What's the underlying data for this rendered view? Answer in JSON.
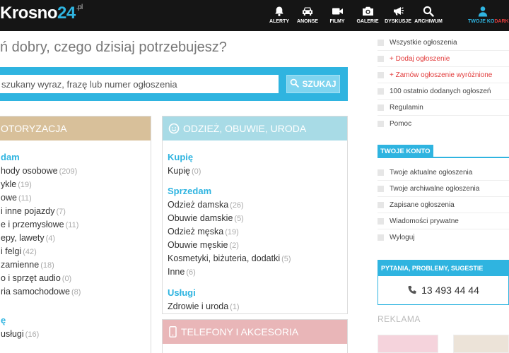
{
  "brand": {
    "logo_text": "Krosno",
    "logo_num": "24",
    "logo_tld": ".pl",
    "accent": "#2fb4e0",
    "danger": "#e23c3c"
  },
  "nav": [
    {
      "label": "ALERTY",
      "icon": "bell-icon"
    },
    {
      "label": "ANONSE",
      "icon": "car-icon"
    },
    {
      "label": "FILMY",
      "icon": "video-camera-icon"
    },
    {
      "label": "GALERIE",
      "icon": "camera-icon"
    },
    {
      "label": "DYSKUSJE",
      "icon": "megaphone-icon"
    },
    {
      "label": "ARCHIWUM",
      "icon": "search-icon"
    }
  ],
  "account": {
    "label": "TWOJE KO",
    "label_red": "DARK",
    "icon": "user-icon"
  },
  "headline": "ń dobry, czego dzisiaj potrzebujesz?",
  "search": {
    "value": "szukany wyraz, frazę lub numer ogłoszenia",
    "button": "SZUKAJ"
  },
  "categories": {
    "moto": {
      "title": "OTORYZACJA",
      "color": "#d8c09a",
      "sections": [
        {
          "title": "dam",
          "items": [
            {
              "name": "hody osobowe",
              "count": "(209)"
            },
            {
              "name": "ykle",
              "count": "(19)"
            },
            {
              "name": "owe",
              "count": "(11)"
            },
            {
              "name": "i inne pojazdy",
              "count": "(7)"
            },
            {
              "name": "e i przemysłowe",
              "count": "(11)"
            },
            {
              "name": "epy, lawety",
              "count": "(4)"
            },
            {
              "name": "i felgi",
              "count": "(42)"
            },
            {
              "name": "zamienne",
              "count": "(18)"
            },
            {
              "name": "o i sprzęt audio",
              "count": "(0)"
            },
            {
              "name": "ria samochodowe",
              "count": "(8)"
            }
          ]
        },
        {
          "title": "ę",
          "items": [
            {
              "name": "usługi",
              "count": "(16)"
            }
          ]
        }
      ]
    },
    "odziez": {
      "title": "ODZIEŻ, OBUWIE, URODA",
      "color": "#a8dbe6",
      "sections": [
        {
          "title": "Kupię",
          "items": [
            {
              "name": "Kupię",
              "count": "(0)"
            }
          ]
        },
        {
          "title": "Sprzedam",
          "items": [
            {
              "name": "Odzież damska",
              "count": "(26)"
            },
            {
              "name": "Obuwie damskie",
              "count": "(5)"
            },
            {
              "name": "Odzież męska",
              "count": "(19)"
            },
            {
              "name": "Obuwie męskie",
              "count": "(2)"
            },
            {
              "name": "Kosmetyki, biżuteria, dodatki",
              "count": "(5)"
            },
            {
              "name": "Inne",
              "count": "(6)"
            }
          ]
        },
        {
          "title": "Usługi",
          "items": [
            {
              "name": "Zdrowie i uroda",
              "count": "(1)"
            }
          ]
        }
      ]
    },
    "telefony": {
      "title": "TELEFONY I AKCESORIA",
      "color": "#e9b6b8"
    }
  },
  "sidebar": {
    "top_items": [
      {
        "label": "Wszystkie ogłoszenia",
        "red": false
      },
      {
        "label": "+ Dodaj ogłoszenie",
        "red": true
      },
      {
        "label": "+ Zamów ogłoszenie wyróżnione",
        "red": true
      },
      {
        "label": "100 ostatnio dodanych ogłoszeń",
        "red": false
      },
      {
        "label": "Regulamin",
        "red": false
      },
      {
        "label": "Pomoc",
        "red": false
      }
    ],
    "konto_title": "TWOJE KONTO",
    "konto_items": [
      {
        "label": "Twoje aktualne ogłoszenia"
      },
      {
        "label": "Twoje archiwalne ogłoszenia"
      },
      {
        "label": "Zapisane ogłoszenia"
      },
      {
        "label": "Wiadomości prywatne"
      },
      {
        "label": "Wyloguj"
      }
    ],
    "help_title": "PYTANIA, PROBLEMY, SUGESTIE",
    "phone": "13 493 44 44",
    "reklama": "REKLAMA"
  }
}
